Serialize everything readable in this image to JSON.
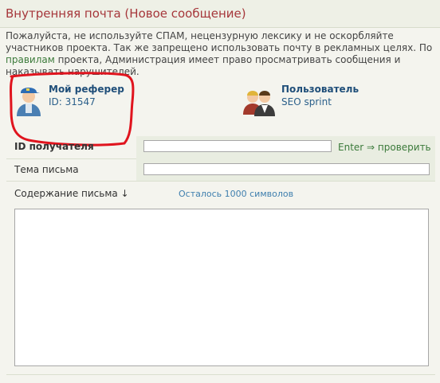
{
  "header": {
    "title": "Внутренняя почта (Новое сообщение)"
  },
  "notice": {
    "part1": "Пожалуйста, не используйте СПАМ, нецензурную лексику и не оскорбляйте участников проекта. Так же запрещено использовать почту в рекламных целях. По ",
    "link": "правилам",
    "part2": " проекта, Администрация имеет право просматривать сообщения и наказывать нарушителей."
  },
  "referer": {
    "name": "Мой реферер",
    "id_text": "ID: 31547",
    "icon": "user-avatar-icon"
  },
  "user": {
    "name": "Пользователь",
    "sub": "SEO sprint",
    "icon": "users-group-icon"
  },
  "form": {
    "recipient_label": "ID получателя",
    "recipient_value": "",
    "recipient_hint": "Enter ⇒ проверить",
    "subject_label": "Тема письма",
    "subject_value": "",
    "body_label": "Содержание письма ↓",
    "counter": "Осталось 1000 символов",
    "body_value": ""
  },
  "colors": {
    "title": "#a6373b",
    "link": "#3b7a3a",
    "username": "#1f4e79",
    "highlight": "#e0141e"
  }
}
